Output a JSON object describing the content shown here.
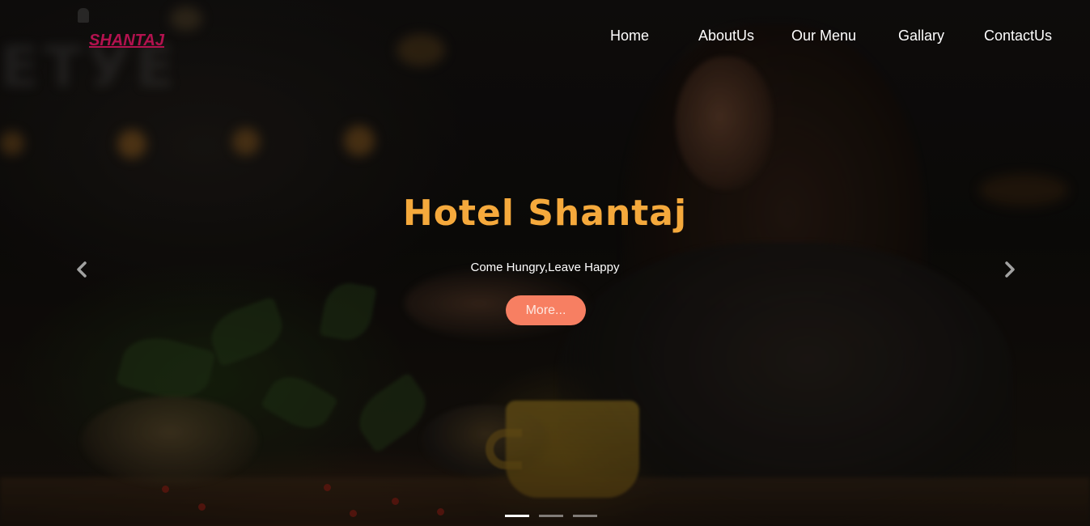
{
  "brand": {
    "name": "SHANTAJ"
  },
  "nav": {
    "items": [
      {
        "label": "Home"
      },
      {
        "label": "AboutUs"
      },
      {
        "label": "Our Menu"
      },
      {
        "label": "Gallary"
      },
      {
        "label": "ContactUs"
      }
    ]
  },
  "hero": {
    "title": "Hotel Shantaj",
    "subtitle": "Come Hungry,Leave Happy",
    "button_label": "More..."
  },
  "carousel": {
    "prev_icon": "chevron-left-icon",
    "next_icon": "chevron-right-icon",
    "slide_count": 3,
    "active_slide": 1
  },
  "colors": {
    "brand": "#b3124f",
    "title": "#f5a93c",
    "button": "#f77f62",
    "nav_text": "#ffffff"
  }
}
